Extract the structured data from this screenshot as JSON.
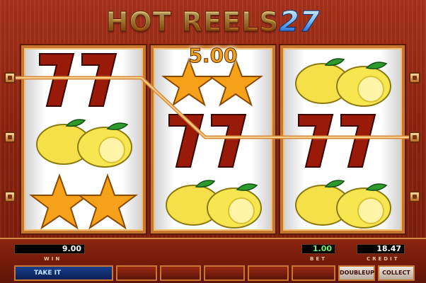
{
  "game": {
    "title_main": "HOT REELS",
    "title_number": "27"
  },
  "win_display": "5.00",
  "reels": [
    [
      "seven",
      "lemon",
      "star"
    ],
    [
      "star",
      "seven",
      "lemon"
    ],
    [
      "lemon",
      "seven",
      "lemon"
    ]
  ],
  "meters": {
    "win_value": "9.00",
    "win_label": "WIN",
    "bet_value": "1.00",
    "bet_label": "BET",
    "credit_value": "18.47",
    "credit_label": "CREDIT"
  },
  "buttons": {
    "take_it": "TAKE IT",
    "doubleup": "DOUBLEUP",
    "collect": "COLLECT"
  },
  "colors": {
    "background": "#8e2410",
    "frame": "#c9772e",
    "seven": "#9a1a0a",
    "lemon": "#f6e04a",
    "star": "#f5a21a"
  }
}
